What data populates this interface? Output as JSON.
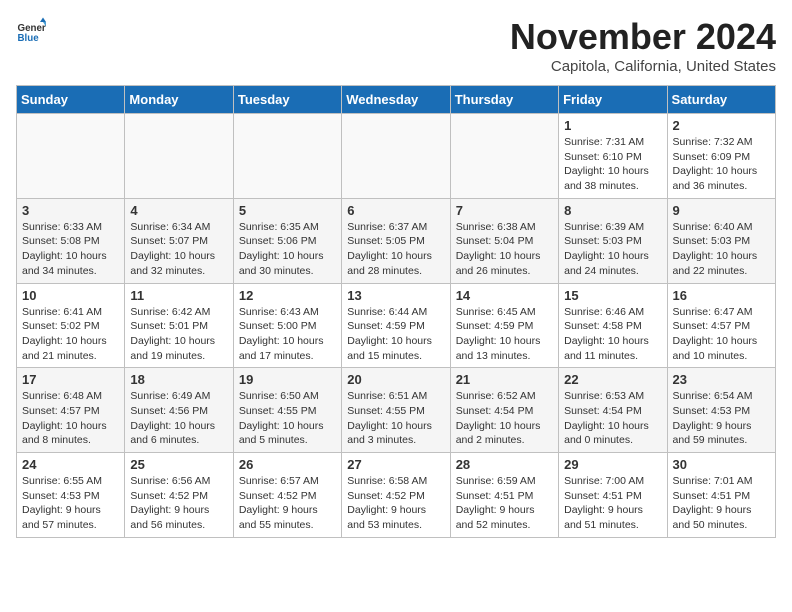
{
  "logo": {
    "general": "General",
    "blue": "Blue"
  },
  "title": "November 2024",
  "location": "Capitola, California, United States",
  "days_of_week": [
    "Sunday",
    "Monday",
    "Tuesday",
    "Wednesday",
    "Thursday",
    "Friday",
    "Saturday"
  ],
  "weeks": [
    [
      {
        "day": "",
        "info": ""
      },
      {
        "day": "",
        "info": ""
      },
      {
        "day": "",
        "info": ""
      },
      {
        "day": "",
        "info": ""
      },
      {
        "day": "",
        "info": ""
      },
      {
        "day": "1",
        "info": "Sunrise: 7:31 AM\nSunset: 6:10 PM\nDaylight: 10 hours and 38 minutes."
      },
      {
        "day": "2",
        "info": "Sunrise: 7:32 AM\nSunset: 6:09 PM\nDaylight: 10 hours and 36 minutes."
      }
    ],
    [
      {
        "day": "3",
        "info": "Sunrise: 6:33 AM\nSunset: 5:08 PM\nDaylight: 10 hours and 34 minutes."
      },
      {
        "day": "4",
        "info": "Sunrise: 6:34 AM\nSunset: 5:07 PM\nDaylight: 10 hours and 32 minutes."
      },
      {
        "day": "5",
        "info": "Sunrise: 6:35 AM\nSunset: 5:06 PM\nDaylight: 10 hours and 30 minutes."
      },
      {
        "day": "6",
        "info": "Sunrise: 6:37 AM\nSunset: 5:05 PM\nDaylight: 10 hours and 28 minutes."
      },
      {
        "day": "7",
        "info": "Sunrise: 6:38 AM\nSunset: 5:04 PM\nDaylight: 10 hours and 26 minutes."
      },
      {
        "day": "8",
        "info": "Sunrise: 6:39 AM\nSunset: 5:03 PM\nDaylight: 10 hours and 24 minutes."
      },
      {
        "day": "9",
        "info": "Sunrise: 6:40 AM\nSunset: 5:03 PM\nDaylight: 10 hours and 22 minutes."
      }
    ],
    [
      {
        "day": "10",
        "info": "Sunrise: 6:41 AM\nSunset: 5:02 PM\nDaylight: 10 hours and 21 minutes."
      },
      {
        "day": "11",
        "info": "Sunrise: 6:42 AM\nSunset: 5:01 PM\nDaylight: 10 hours and 19 minutes."
      },
      {
        "day": "12",
        "info": "Sunrise: 6:43 AM\nSunset: 5:00 PM\nDaylight: 10 hours and 17 minutes."
      },
      {
        "day": "13",
        "info": "Sunrise: 6:44 AM\nSunset: 4:59 PM\nDaylight: 10 hours and 15 minutes."
      },
      {
        "day": "14",
        "info": "Sunrise: 6:45 AM\nSunset: 4:59 PM\nDaylight: 10 hours and 13 minutes."
      },
      {
        "day": "15",
        "info": "Sunrise: 6:46 AM\nSunset: 4:58 PM\nDaylight: 10 hours and 11 minutes."
      },
      {
        "day": "16",
        "info": "Sunrise: 6:47 AM\nSunset: 4:57 PM\nDaylight: 10 hours and 10 minutes."
      }
    ],
    [
      {
        "day": "17",
        "info": "Sunrise: 6:48 AM\nSunset: 4:57 PM\nDaylight: 10 hours and 8 minutes."
      },
      {
        "day": "18",
        "info": "Sunrise: 6:49 AM\nSunset: 4:56 PM\nDaylight: 10 hours and 6 minutes."
      },
      {
        "day": "19",
        "info": "Sunrise: 6:50 AM\nSunset: 4:55 PM\nDaylight: 10 hours and 5 minutes."
      },
      {
        "day": "20",
        "info": "Sunrise: 6:51 AM\nSunset: 4:55 PM\nDaylight: 10 hours and 3 minutes."
      },
      {
        "day": "21",
        "info": "Sunrise: 6:52 AM\nSunset: 4:54 PM\nDaylight: 10 hours and 2 minutes."
      },
      {
        "day": "22",
        "info": "Sunrise: 6:53 AM\nSunset: 4:54 PM\nDaylight: 10 hours and 0 minutes."
      },
      {
        "day": "23",
        "info": "Sunrise: 6:54 AM\nSunset: 4:53 PM\nDaylight: 9 hours and 59 minutes."
      }
    ],
    [
      {
        "day": "24",
        "info": "Sunrise: 6:55 AM\nSunset: 4:53 PM\nDaylight: 9 hours and 57 minutes."
      },
      {
        "day": "25",
        "info": "Sunrise: 6:56 AM\nSunset: 4:52 PM\nDaylight: 9 hours and 56 minutes."
      },
      {
        "day": "26",
        "info": "Sunrise: 6:57 AM\nSunset: 4:52 PM\nDaylight: 9 hours and 55 minutes."
      },
      {
        "day": "27",
        "info": "Sunrise: 6:58 AM\nSunset: 4:52 PM\nDaylight: 9 hours and 53 minutes."
      },
      {
        "day": "28",
        "info": "Sunrise: 6:59 AM\nSunset: 4:51 PM\nDaylight: 9 hours and 52 minutes."
      },
      {
        "day": "29",
        "info": "Sunrise: 7:00 AM\nSunset: 4:51 PM\nDaylight: 9 hours and 51 minutes."
      },
      {
        "day": "30",
        "info": "Sunrise: 7:01 AM\nSunset: 4:51 PM\nDaylight: 9 hours and 50 minutes."
      }
    ]
  ]
}
